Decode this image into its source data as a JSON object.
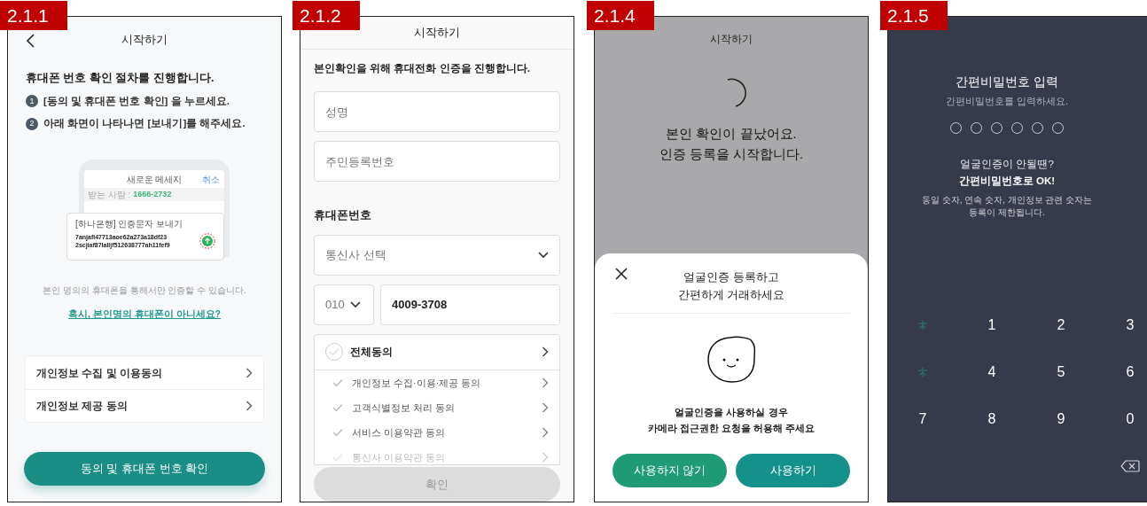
{
  "screens": [
    {
      "kind": "consent",
      "label": "2.1.1",
      "title": "시작하기",
      "heading": "휴대폰 번호 확인 절차를 진행합니다.",
      "steps": [
        {
          "number": "1",
          "text": "[동의 및 휴대폰 번호 확인] 을 누르세요."
        },
        {
          "number": "2",
          "text": "아래 화면이 나타나면 [보내기]를 해주세요."
        }
      ],
      "illustration": {
        "title": "새로운 메세지",
        "cancel": "취소",
        "recipient_label": "받는 사람 :",
        "recipient": "1666-2732",
        "card_title": "[하나은행] 인증문자 보내기",
        "code_lines": [
          "7anjafi47713aoe62a273a18df23",
          "2scjiaf87lalljf512638777ah11fef9"
        ]
      },
      "notice": "본인 명의의 휴대폰을 통해서만 인증할 수 있습니다.",
      "link": "혹시, 본인명의 휴대폰이 아니세요?",
      "agreements": [
        "개인정보 수집 및 이용동의",
        "개인정보 제공 동의"
      ],
      "button": "동의 및 휴대폰 번호 확인"
    },
    {
      "kind": "form",
      "label": "2.1.2",
      "title": "시작하기",
      "intro": "본인확인을 위해 휴대전화 인증을 진행합니다.",
      "fields": [
        {
          "placeholder": "성명"
        },
        {
          "placeholder": "주민등록번호"
        }
      ],
      "phone_heading": "휴대폰번호",
      "carrier": {
        "placeholder": "통신사 선택"
      },
      "prefix": "010",
      "number": "4009-3708",
      "all_agree": {
        "label": "전체동의",
        "checked": false
      },
      "terms": [
        {
          "label": "개인정보 수집·이용·제공 동의",
          "checked": false
        },
        {
          "label": "고객식별정보 처리 동의",
          "checked": false
        },
        {
          "label": "서비스 이용약관 동의",
          "checked": false
        },
        {
          "label": "통신사 이용약관 동의",
          "checked": false
        }
      ],
      "confirm": {
        "label": "확인",
        "disabled": true
      }
    },
    {
      "kind": "face",
      "label": "2.1.4",
      "title": "시작하기",
      "message": "본인 확인이 끝났어요.\n인증 등록을 시작합니다.",
      "sheet": {
        "title": "얼굴인증 등록하고\n간편하게 거래하세요",
        "body": "얼굴인증을 사용하실 경우\n카메라 접근권한 요청을 허용해 주세요",
        "buttons": [
          {
            "label": "사용하지 않기",
            "kind": "secondary"
          },
          {
            "label": "사용하기",
            "kind": "primary"
          }
        ]
      }
    },
    {
      "kind": "pin",
      "label": "2.1.5",
      "title": "간편비밀번호 입력",
      "subtitle": "간편비밀번호를 입력하세요.",
      "pin_dots": [
        {
          "filled": false
        },
        {
          "filled": false
        },
        {
          "filled": false
        },
        {
          "filled": false
        },
        {
          "filled": false
        },
        {
          "filled": false
        }
      ],
      "hint": "얼굴인증이 안될땐?",
      "hint_bold": "간편비밀번호로 OK!",
      "rule": "동일 숫자, 연속 숫자, 개인정보 관련 숫자는\n등록이 제한됩니다.",
      "keys": [
        {
          "kind": "mark"
        },
        {
          "kind": "digit",
          "label": "1"
        },
        {
          "kind": "digit",
          "label": "2"
        },
        {
          "kind": "digit",
          "label": "3"
        },
        {
          "kind": "mark"
        },
        {
          "kind": "digit",
          "label": "4"
        },
        {
          "kind": "digit",
          "label": "5"
        },
        {
          "kind": "digit",
          "label": "6"
        },
        {
          "kind": "digit",
          "label": "7"
        },
        {
          "kind": "digit",
          "label": "8"
        },
        {
          "kind": "digit",
          "label": "9"
        },
        {
          "kind": "digit",
          "label": "0"
        },
        {
          "kind": "empty"
        },
        {
          "kind": "empty"
        },
        {
          "kind": "empty"
        },
        {
          "kind": "backspace"
        }
      ]
    }
  ]
}
